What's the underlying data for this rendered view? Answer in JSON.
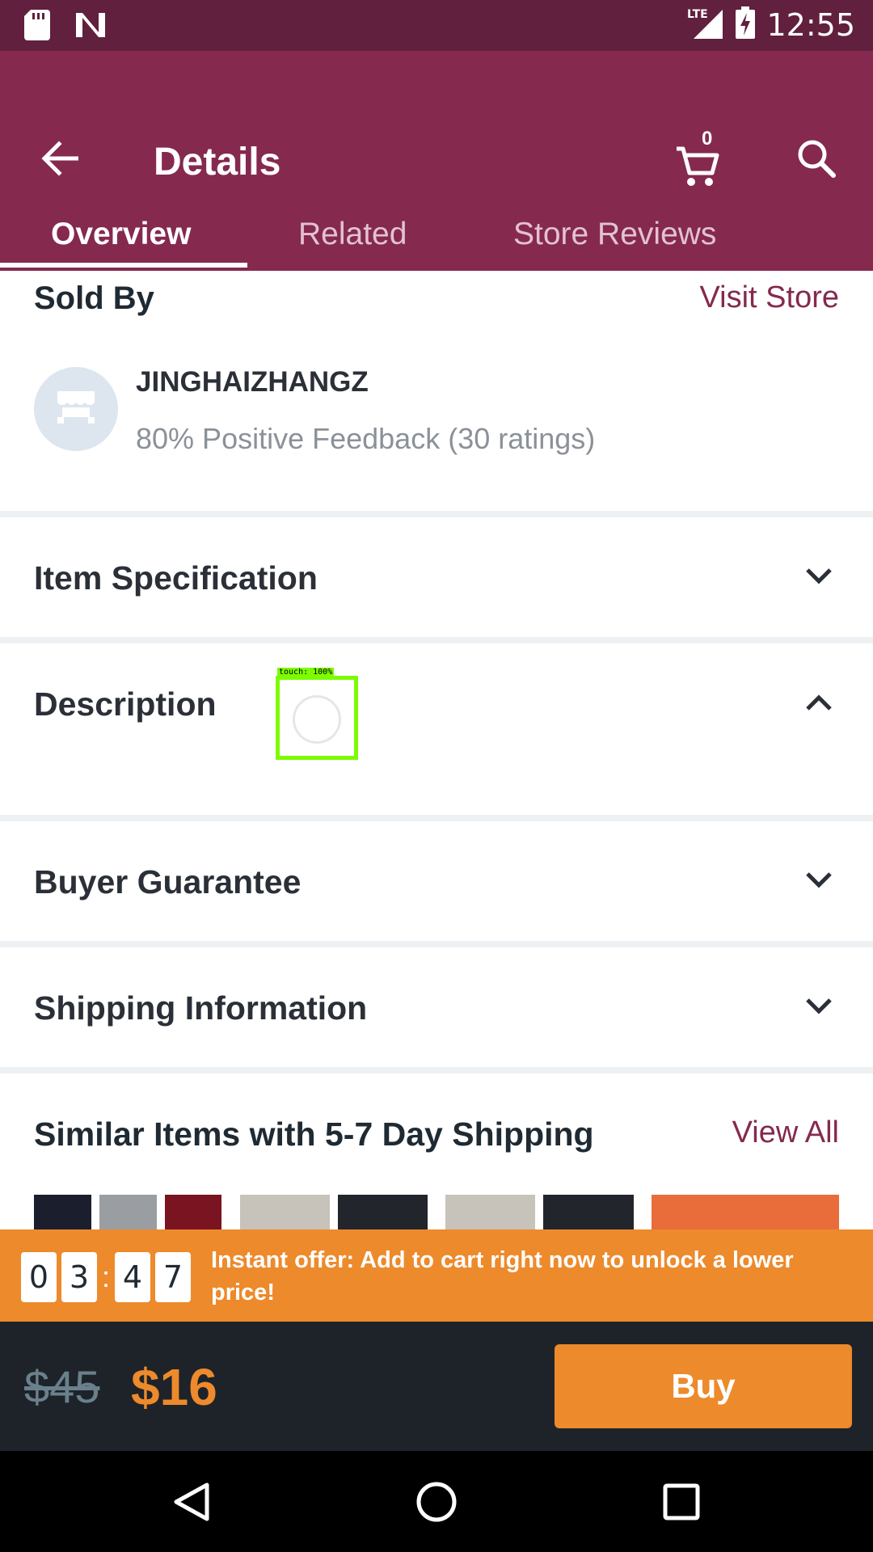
{
  "status_bar": {
    "time": "12:55",
    "network": "LTE",
    "icons": [
      "sd-card-icon",
      "n-notification-icon",
      "signal-icon",
      "battery-charging-icon"
    ]
  },
  "app_bar": {
    "title": "Details",
    "cart_count": "0",
    "back_icon": "arrow-left-icon",
    "cart_icon": "shopping-cart-icon",
    "search_icon": "search-icon"
  },
  "tabs": [
    {
      "label": "Overview",
      "active": true
    },
    {
      "label": "Related",
      "active": false
    },
    {
      "label": "Store Reviews",
      "active": false
    }
  ],
  "sold_by": {
    "header": "Sold By",
    "visit_store": "Visit Store",
    "store_name": "JINGHAIZHANGZ",
    "feedback": "80% Positive Feedback (30 ratings)"
  },
  "sections": [
    {
      "title": "Item Specification",
      "expanded": false
    },
    {
      "title": "Description",
      "expanded": true
    },
    {
      "title": "Buyer Guarantee",
      "expanded": false
    },
    {
      "title": "Shipping Information",
      "expanded": false
    }
  ],
  "touch_indicator": {
    "label": "touch: 100%"
  },
  "similar": {
    "title": "Similar Items with 5-7 Day Shipping",
    "view_all": "View All"
  },
  "offer": {
    "timer_digits": [
      "0",
      "3",
      "4",
      "7"
    ],
    "separator": ":",
    "text": "Instant offer: Add to cart right now to unlock a lower price!"
  },
  "buy_bar": {
    "old_price": "$45",
    "new_price": "$16",
    "buy_label": "Buy"
  },
  "colors": {
    "status_bar": "#61203d",
    "app_bar": "#85294f",
    "accent": "#ed8a2c",
    "buy_bar": "#1e2329"
  }
}
